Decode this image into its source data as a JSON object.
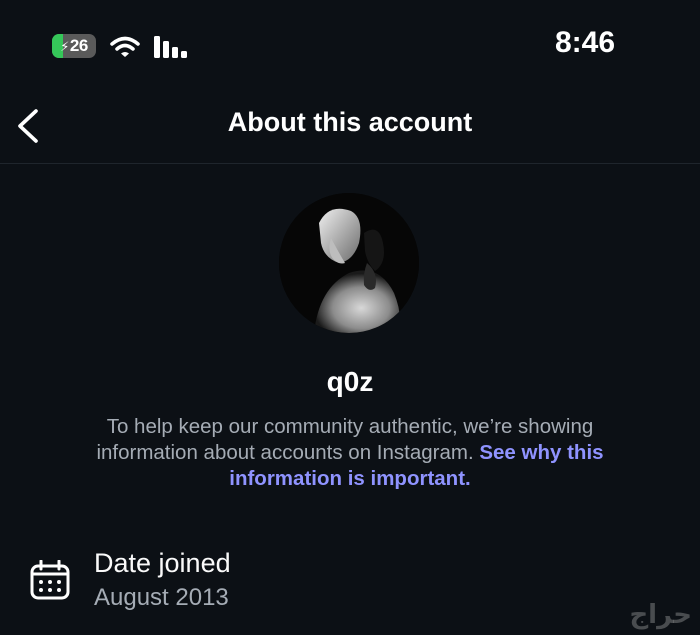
{
  "status_bar": {
    "battery_level": "26",
    "battery_fraction": 0.26,
    "charging": true,
    "wifi_icon": "wifi-icon",
    "signal_icon": "signal-bars-icon",
    "time": "8:46"
  },
  "header": {
    "back_icon": "chevron-left-icon",
    "title": "About this account"
  },
  "profile": {
    "avatar": "profile-photo",
    "username": "q0z",
    "description": "To help keep our community authentic, we’re showing information about accounts on Instagram.",
    "link_text": "See why this information is important."
  },
  "details": [
    {
      "icon": "calendar-icon",
      "label": "Date joined",
      "value": "August 2013"
    }
  ],
  "watermark": "حراج",
  "colors": {
    "background": "#0c1015",
    "link": "#8f93ff",
    "secondary_text": "#a5acb5",
    "battery_green": "#35c759"
  }
}
